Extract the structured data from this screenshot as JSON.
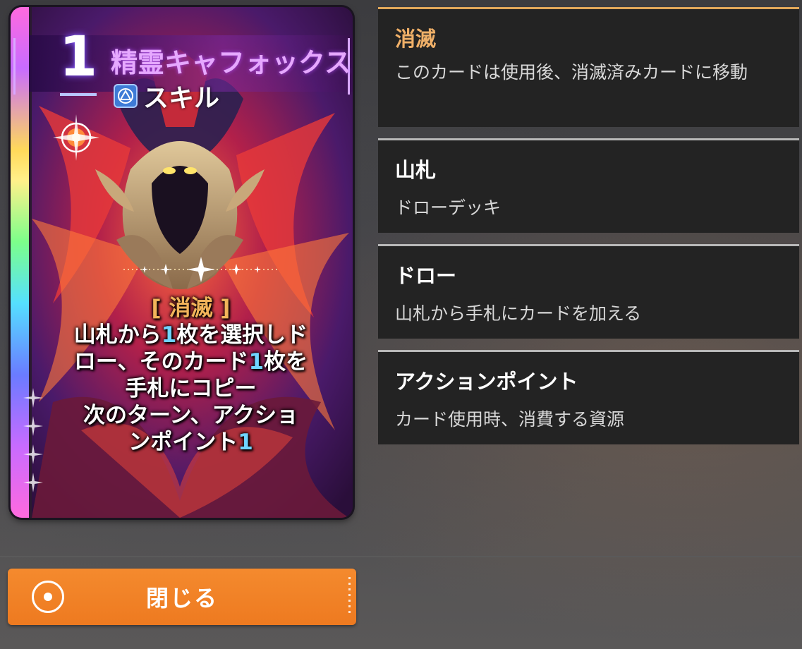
{
  "card": {
    "cost": "1",
    "name": "精霊キャフォックス",
    "type": "スキル",
    "type_icon": "skill-triangle-icon",
    "rarity_icon": "compass-star-icon",
    "effect": {
      "keyword": "[ 消滅 ]",
      "line1_a": "山札から",
      "line1_num": "1",
      "line1_b": "枚を選択しド",
      "line2_a": "ロー、そのカード",
      "line2_num": "1",
      "line2_b": "枚を",
      "line3": "手札にコピー",
      "line4": "次のターン、アクショ",
      "line5_a": "ンポイント",
      "line5_num": "1"
    },
    "colors": {
      "name": "#e6a8ff",
      "keyword": "#f2b45a",
      "number": "#6fd4ff"
    }
  },
  "keywords": [
    {
      "title": "消滅",
      "desc": "このカードは使用後、消滅済みカードに移動"
    },
    {
      "title": "山札",
      "desc": "ドローデッキ"
    },
    {
      "title": "ドロー",
      "desc": "山札から手札にカードを加える"
    },
    {
      "title": "アクションポイント",
      "desc": "カード使用時、消費する資源"
    }
  ],
  "footer": {
    "close_label": "閉じる",
    "close_icon": "circle-dot-icon",
    "accent": "#f28428"
  }
}
